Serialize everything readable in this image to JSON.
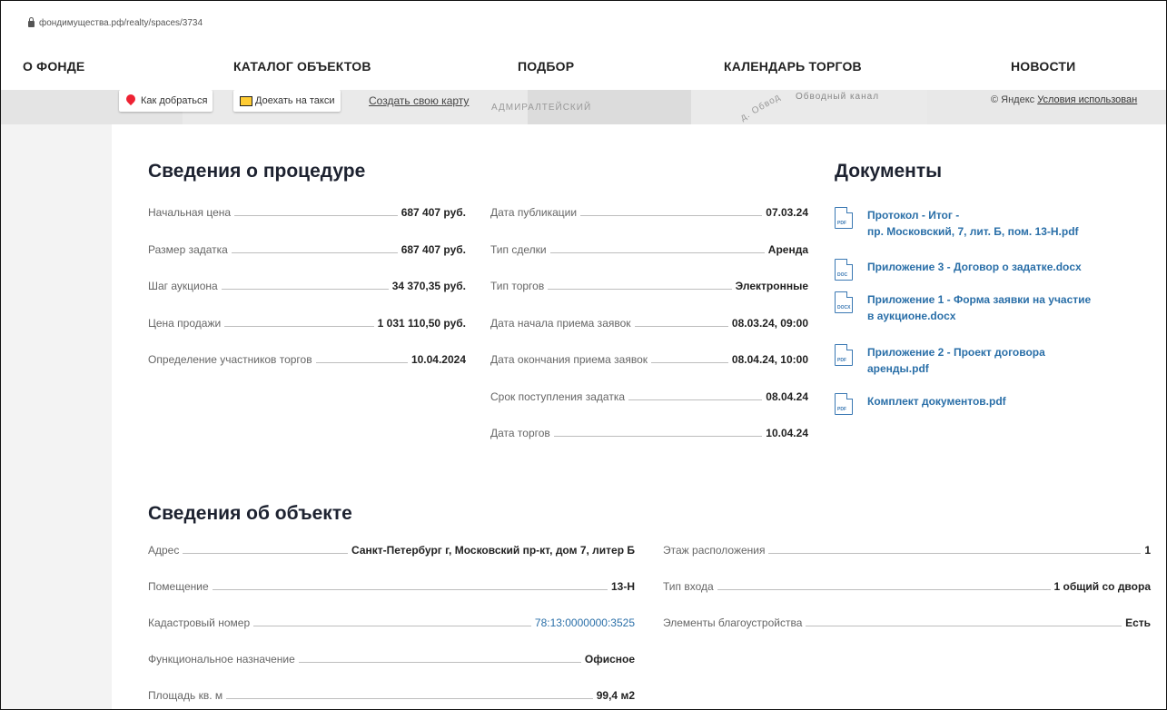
{
  "browser": {
    "url": "фондимущества.рф/realty/spaces/3734"
  },
  "nav": [
    "О ФОНДЕ",
    "КАТАЛОГ ОБЪЕКТОВ",
    "ПОДБОР",
    "КАЛЕНДАРЬ ТОРГОВ",
    "НОВОСТИ"
  ],
  "map": {
    "route_label": "Как добраться",
    "taxi_label": "Доехать на такси",
    "create_map_label": "Создать свою карту",
    "place_admiral": "АДМИРАЛТЕЙСКИЙ",
    "place_obvod": "Обводный канал",
    "place_obv2": "д. Обвод",
    "copyright": "© Яндекс",
    "terms": "Условия использован"
  },
  "procedure": {
    "title": "Сведения о процедуре",
    "left": [
      {
        "label": "Начальная цена",
        "value": "687 407 руб."
      },
      {
        "label": "Размер задатка",
        "value": "687 407 руб."
      },
      {
        "label": "Шаг аукциона",
        "value": "34 370,35 руб."
      },
      {
        "label": "Цена продажи",
        "value": "1 031 110,50 руб."
      },
      {
        "label": "Определение участников торгов",
        "value": "10.04.2024"
      }
    ],
    "right": [
      {
        "label": "Дата публикации",
        "value": "07.03.24"
      },
      {
        "label": "Тип сделки",
        "value": "Аренда"
      },
      {
        "label": "Тип торгов",
        "value": "Электронные"
      },
      {
        "label": "Дата начала приема заявок",
        "value": "08.03.24, 09:00"
      },
      {
        "label": "Дата окончания приема заявок",
        "value": "08.04.24, 10:00"
      },
      {
        "label": "Срок поступления задатка",
        "value": "08.04.24"
      },
      {
        "label": "Дата торгов",
        "value": "10.04.24"
      }
    ]
  },
  "documents": {
    "title": "Документы",
    "items": [
      {
        "type": "PDF",
        "line1": "Протокол - Итог -",
        "line2": "пр. Московский, 7, лит. Б, пом. 13-Н.pdf"
      },
      {
        "type": "DOC",
        "line1": "Приложение 3 - Договор о задатке.docx",
        "line2": ""
      },
      {
        "type": "DOCX",
        "line1": "Приложение 1 - Форма заявки на участие",
        "line2": "в аукционе.docx"
      },
      {
        "type": "PDF",
        "line1": "Приложение 2 - Проект договора",
        "line2": "аренды.pdf"
      },
      {
        "type": "PDF",
        "line1": "Комплект документов.pdf",
        "line2": ""
      }
    ]
  },
  "object": {
    "title": "Сведения об объекте",
    "left": [
      {
        "label": "Адрес",
        "value": "Санкт-Петербург г, Московский пр-кт, дом 7, литер Б"
      },
      {
        "label": "Помещение",
        "value": "13-Н"
      },
      {
        "label": "Кадастровый номер",
        "value": "78:13:0000000:3525"
      },
      {
        "label": "Функциональное назначение",
        "value": "Офисное"
      },
      {
        "label": "Площадь кв. м",
        "value": "99,4 м2"
      }
    ],
    "right": [
      {
        "label": "Этаж расположения",
        "value": "1"
      },
      {
        "label": "Тип входа",
        "value": "1 общий со двора"
      },
      {
        "label": "Элементы благоустройства",
        "value": "Есть"
      }
    ]
  }
}
